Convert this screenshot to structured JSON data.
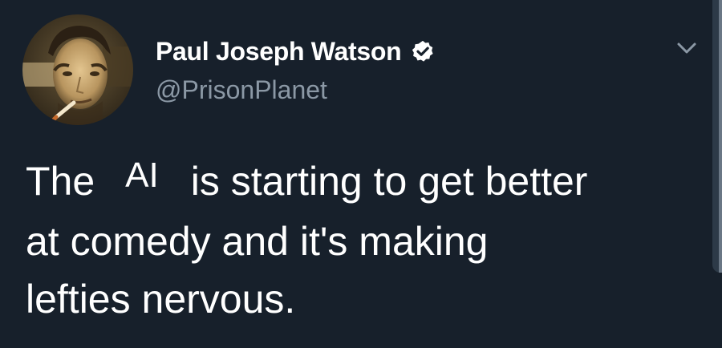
{
  "author": {
    "display_name": "Paul Joseph Watson",
    "handle": "@PrisonPlanet",
    "avatar_icon": "profile-photo",
    "verified_icon": "verified-badge-icon"
  },
  "menu_icon": "chevron-down-icon",
  "tweet": {
    "line1_start": "The",
    "inserted_word": "AI",
    "line1_end": "is starting to get better",
    "line2": "at comedy and it's making",
    "line3": "lefties nervous."
  },
  "colors": {
    "background": "#17202b",
    "text": "#ffffff",
    "secondary_text": "#8b98a5"
  }
}
